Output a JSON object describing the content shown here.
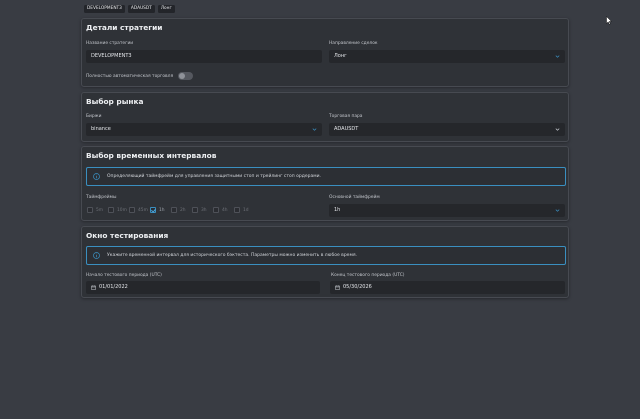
{
  "tags": [
    "DEVELOPMENT3",
    "ADAUSDT",
    "Лонг"
  ],
  "strategy": {
    "title": "Детали стратегии",
    "name_label": "Название стратегии",
    "name_value": "DEVELOPMENT3",
    "direction_label": "Направление сделок",
    "direction_value": "Лонг",
    "auto_label": "Полностью автоматическая торговля",
    "auto_enabled": false
  },
  "market": {
    "title": "Выбор рынка",
    "exchange_label": "Биржи",
    "exchange_value": "binance",
    "pair_label": "Торговая пара",
    "pair_value": "ADAUSDT"
  },
  "intervals": {
    "title": "Выбор временных интервалов",
    "info_text": "Определяющий таймфрейм для управления защитными стоп и трейлинг стоп ордерами.",
    "timeframes_label": "Таймфреймы",
    "timeframes": [
      {
        "label": "5m",
        "checked": false
      },
      {
        "label": "10m",
        "checked": false
      },
      {
        "label": "45m",
        "checked": false
      },
      {
        "label": "1h",
        "checked": true
      },
      {
        "label": "2h",
        "checked": false
      },
      {
        "label": "3h",
        "checked": false
      },
      {
        "label": "4h",
        "checked": false
      },
      {
        "label": "1d",
        "checked": false
      }
    ],
    "main_tf_label": "Основной таймфрейм",
    "main_tf_value": "1h"
  },
  "testing": {
    "title": "Окно тестирования",
    "info_text": "Укажите временной интервал для исторического бэктеста. Параметры можно изменить в любое время.",
    "start_label": "Начало тестового периода (UTC)",
    "start_value": "01/01/2022",
    "end_label": "Конец тестового периода (UTC)",
    "end_value": "05/30/2026"
  },
  "icons": {
    "chevron": "chevron-down-icon",
    "info": "info-icon",
    "calendar": "calendar-icon",
    "cursor": "mouse-pointer-icon"
  },
  "colors": {
    "background": "#393c43",
    "card": "#2f3237",
    "field": "#25272b",
    "accent": "#3a8fc0"
  }
}
